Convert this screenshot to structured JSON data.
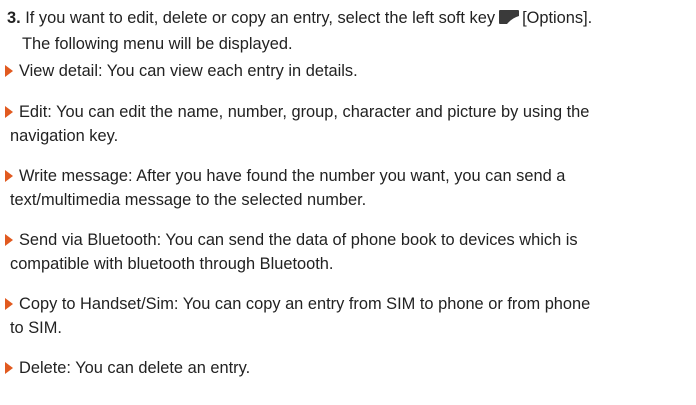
{
  "step": {
    "number": "3.",
    "text_before_icon": "If you want to edit, delete or copy an entry, select the left soft key",
    "softkey_icon": "left-soft-key-icon",
    "text_after_icon": "[Options].",
    "line2": "The following menu will be displayed."
  },
  "items": [
    {
      "term": "View detail:",
      "line1": " You can view each entry in details.",
      "line2": ""
    },
    {
      "term": "Edit:",
      "line1": " You can edit the name, number, group, character and picture by using the",
      "line2": "navigation key."
    },
    {
      "term": "Write message:",
      "line1": " After you have found the number you want, you can send a",
      "line2": "text/multimedia message to the selected number."
    },
    {
      "term": "Send via Bluetooth:",
      "line1": " You can send the data of phone book to devices which is",
      "line2": "compatible with bluetooth through Bluetooth."
    },
    {
      "term": "Copy to Handset/Sim:",
      "line1": " You can copy an entry from SIM to phone or from phone",
      "line2": "to SIM."
    },
    {
      "term": "Delete:",
      "line1": " You can delete an entry.",
      "line2": ""
    }
  ],
  "colors": {
    "bullet_arrow": "#e15a20",
    "text": "#222222",
    "icon": "#3a3a3a"
  }
}
